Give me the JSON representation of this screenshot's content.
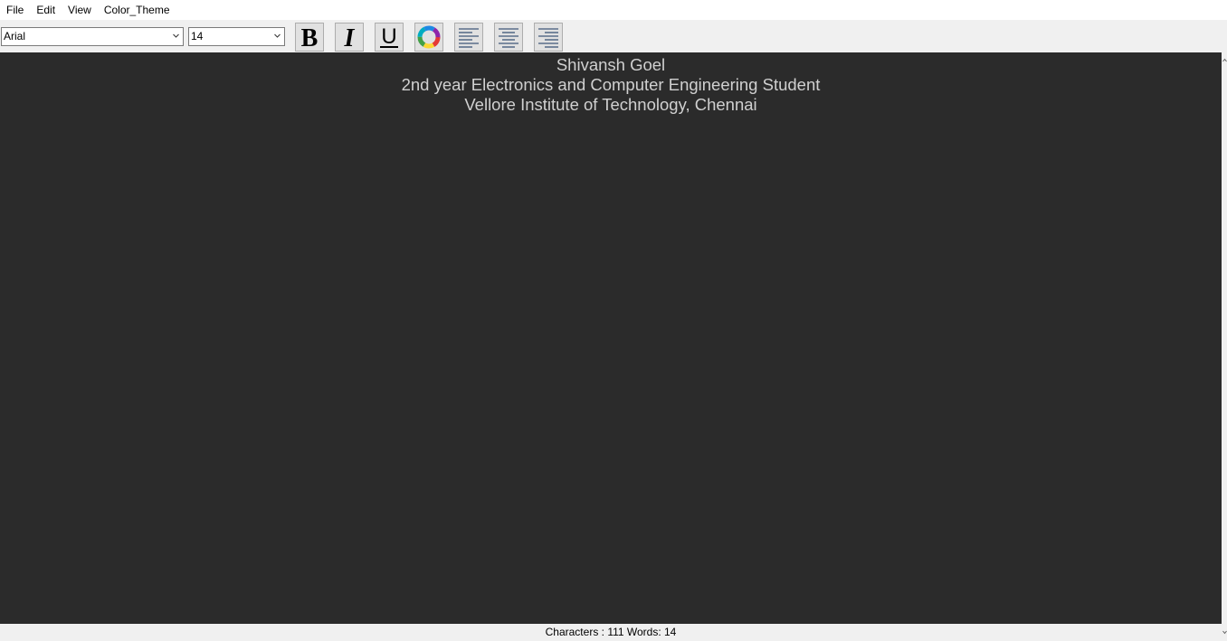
{
  "menubar": {
    "items": [
      {
        "label": "File"
      },
      {
        "label": "Edit"
      },
      {
        "label": "View"
      },
      {
        "label": "Color_Theme"
      }
    ]
  },
  "toolbar": {
    "font_family": "Arial",
    "font_size": "14",
    "buttons": [
      {
        "name": "bold",
        "icon": "bold-icon"
      },
      {
        "name": "italic",
        "icon": "italic-icon"
      },
      {
        "name": "underline",
        "icon": "underline-icon"
      },
      {
        "name": "font-color",
        "icon": "color-wheel-icon"
      },
      {
        "name": "align-left",
        "icon": "align-left-icon"
      },
      {
        "name": "align-center",
        "icon": "align-center-icon"
      },
      {
        "name": "align-right",
        "icon": "align-right-icon"
      }
    ]
  },
  "editor": {
    "background": "#2b2b2b",
    "text_color": "#d0d0d0",
    "lines": [
      "Shivansh Goel",
      "2nd year Electronics and Computer Engineering Student",
      "Vellore Institute of Technology, Chennai"
    ]
  },
  "status": {
    "text": "Characters : 111 Words: 14"
  }
}
